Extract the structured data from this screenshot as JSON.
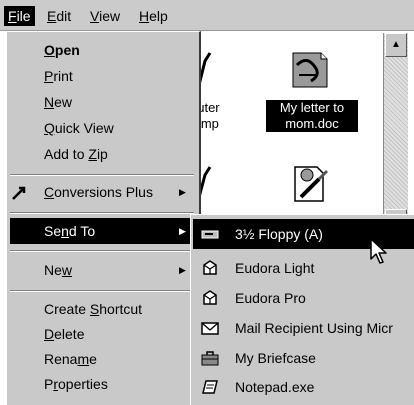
{
  "menubar": {
    "items": [
      {
        "pre": "",
        "key": "F",
        "post": "ile"
      },
      {
        "pre": "",
        "key": "E",
        "post": "dit"
      },
      {
        "pre": "",
        "key": "V",
        "post": "iew"
      },
      {
        "pre": "",
        "key": "H",
        "post": "elp"
      }
    ]
  },
  "folder": {
    "partial_file_label_1": "puter",
    "partial_file_label_2": ".bmp",
    "selected_file_label_1": "My letter to",
    "selected_file_label_2": "mom.doc"
  },
  "file_menu": {
    "items": [
      {
        "pre": "",
        "key": "O",
        "post": "pen"
      },
      {
        "pre": "",
        "key": "P",
        "post": "rint"
      },
      {
        "pre": "",
        "key": "N",
        "post": "ew"
      },
      {
        "pre": "",
        "key": "Q",
        "post": "uick View"
      },
      {
        "pre": "Add to ",
        "key": "Z",
        "post": "ip"
      },
      {
        "pre": "",
        "key": "C",
        "post": "onversions Plus"
      },
      {
        "pre": "Se",
        "key": "n",
        "post": "d To"
      },
      {
        "pre": "Ne",
        "key": "w",
        "post": ""
      },
      {
        "pre": "Create ",
        "key": "S",
        "post": "hortcut"
      },
      {
        "pre": "",
        "key": "D",
        "post": "elete"
      },
      {
        "pre": "Rena",
        "key": "m",
        "post": "e"
      },
      {
        "pre": "P",
        "key": "r",
        "post": "operties"
      }
    ],
    "submenu_arrow": "▶"
  },
  "send_to": {
    "items": [
      {
        "label": "3½ Floppy (A)",
        "icon": "floppy-drive-icon"
      },
      {
        "label": "Eudora Light",
        "icon": "eudora-light-icon"
      },
      {
        "label": "Eudora Pro",
        "icon": "eudora-pro-icon"
      },
      {
        "label": "Mail Recipient Using Micr",
        "icon": "mail-envelope-icon"
      },
      {
        "label": "My Briefcase",
        "icon": "briefcase-icon"
      },
      {
        "label": "Notepad.exe",
        "icon": "notepad-icon"
      }
    ]
  },
  "colors": {
    "menu_bg": "#c9c9c9",
    "highlight": "#000000",
    "menubar_bg": "#cbcbcb"
  }
}
